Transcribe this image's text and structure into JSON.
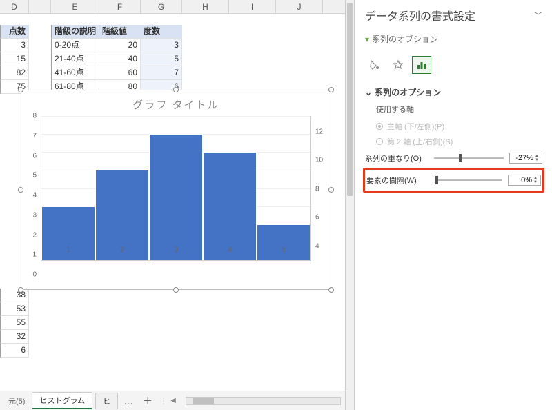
{
  "columns": {
    "D": "D",
    "E": "E",
    "F": "F",
    "G": "G",
    "H": "H",
    "I": "I",
    "J": "J"
  },
  "col_widths": {
    "D": 42,
    "E": 70,
    "F": 60,
    "G": 60,
    "H": 68,
    "I": 68,
    "J": 68
  },
  "table": {
    "headers": {
      "D": "点数",
      "E": "階級の説明",
      "F": "階級値",
      "G": "度数"
    },
    "rows": [
      {
        "D": "3",
        "E": "0-20点",
        "F": "20",
        "G": "3"
      },
      {
        "D": "15",
        "E": "21-40点",
        "F": "40",
        "G": "5"
      },
      {
        "D": "82",
        "E": "41-60点",
        "F": "60",
        "G": "7"
      },
      {
        "D": "75",
        "E": "61-80点",
        "F": "80",
        "G": "6"
      }
    ]
  },
  "lower_values": [
    "38",
    "53",
    "55",
    "32",
    "6"
  ],
  "reference_cell": "元(5)",
  "tabs": {
    "active": "ヒストグラム",
    "next": "ヒ",
    "more": "…",
    "plus": "＋"
  },
  "chart_title": "グラフ タイトル",
  "chart_data": {
    "type": "bar",
    "categories": [
      "1",
      "2",
      "3",
      "4",
      "5"
    ],
    "values": [
      3,
      5,
      7,
      6,
      2
    ],
    "y_left": {
      "min": 0,
      "max": 8,
      "ticks": [
        0,
        1,
        2,
        3,
        4,
        5,
        6,
        7,
        8
      ]
    },
    "y_right": {
      "ticks": [
        4,
        6,
        8,
        10,
        12
      ]
    },
    "title": "グラフ タイトル"
  },
  "pane": {
    "title": "データ系列の書式設定",
    "sub": "系列のオプション",
    "icons": {
      "fill": "fill-icon",
      "effects": "effects-icon",
      "series": "series-icon"
    },
    "section": "系列のオプション",
    "axis_label": "使用する軸",
    "axis_primary": "主軸 (下/左側)(P)",
    "axis_secondary": "第 2 軸 (上/右側)(S)",
    "overlap_label": "系列の重なり(O)",
    "overlap_value": "-27%",
    "gap_label": "要素の間隔(W)",
    "gap_value": "0%"
  }
}
